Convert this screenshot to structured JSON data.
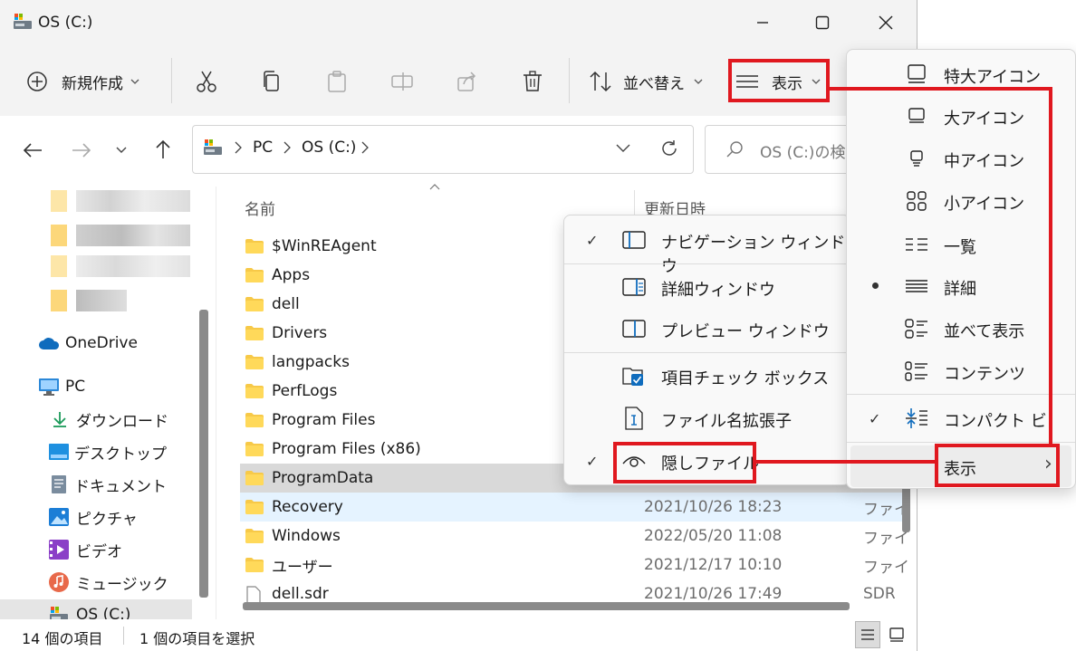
{
  "window": {
    "title": "OS (C:)"
  },
  "toolbar": {
    "new_label": "新規作成",
    "sort_label": "並べ替え",
    "view_label": "表示"
  },
  "address": {
    "crumbs": [
      "PC",
      "OS (C:)"
    ],
    "search_placeholder": "OS (C:)の検索"
  },
  "nav": {
    "onedrive": "OneDrive",
    "pc": "PC",
    "downloads": "ダウンロード",
    "desktop": "デスクトップ",
    "documents": "ドキュメント",
    "pictures": "ピクチャ",
    "videos": "ビデオ",
    "music": "ミュージック",
    "os": "OS (C:)"
  },
  "columns": {
    "name": "名前",
    "date": "更新日時"
  },
  "files": [
    {
      "name": "$WinREAgent",
      "date": "",
      "type": ""
    },
    {
      "name": "Apps",
      "date": "",
      "type": ""
    },
    {
      "name": "dell",
      "date": "",
      "type": ""
    },
    {
      "name": "Drivers",
      "date": "",
      "type": ""
    },
    {
      "name": "langpacks",
      "date": "",
      "type": ""
    },
    {
      "name": "PerfLogs",
      "date": "",
      "type": ""
    },
    {
      "name": "Program Files",
      "date": "",
      "type": ""
    },
    {
      "name": "Program Files (x86)",
      "date": "",
      "type": ""
    },
    {
      "name": "ProgramData",
      "date": "",
      "type": ""
    },
    {
      "name": "Recovery",
      "date": "2021/10/26 18:23",
      "type": "ファイ"
    },
    {
      "name": "Windows",
      "date": "2022/05/20 11:08",
      "type": "ファイ"
    },
    {
      "name": "ユーザー",
      "date": "2021/12/17 10:10",
      "type": "ファイ"
    },
    {
      "name": "dell.sdr",
      "date": "2021/10/26 17:49",
      "type": "SDR"
    }
  ],
  "status": {
    "count": "14 個の項目",
    "selected": "1 個の項目を選択"
  },
  "view_menu": {
    "extra_large": "特大アイコン",
    "large": "大アイコン",
    "medium": "中アイコン",
    "small": "小アイコン",
    "list": "一覧",
    "details": "詳細",
    "tiles": "並べて表示",
    "content": "コンテンツ",
    "compact": "コンパクト ビュー",
    "show": "表示",
    "submenu_arrow": "›"
  },
  "show_menu": {
    "nav_pane": "ナビゲーション ウィンドウ",
    "details_pane": "詳細ウィンドウ",
    "preview_pane": "プレビュー ウィンドウ",
    "item_checkboxes": "項目チェック ボックス",
    "file_extensions": "ファイル名拡張子",
    "hidden_items": "隠しファイル"
  },
  "colors": {
    "highlight": "#e0181f",
    "selected_row": "#d9d9d9",
    "hover_row": "#e5f3ff",
    "folder": "#f7c948"
  }
}
